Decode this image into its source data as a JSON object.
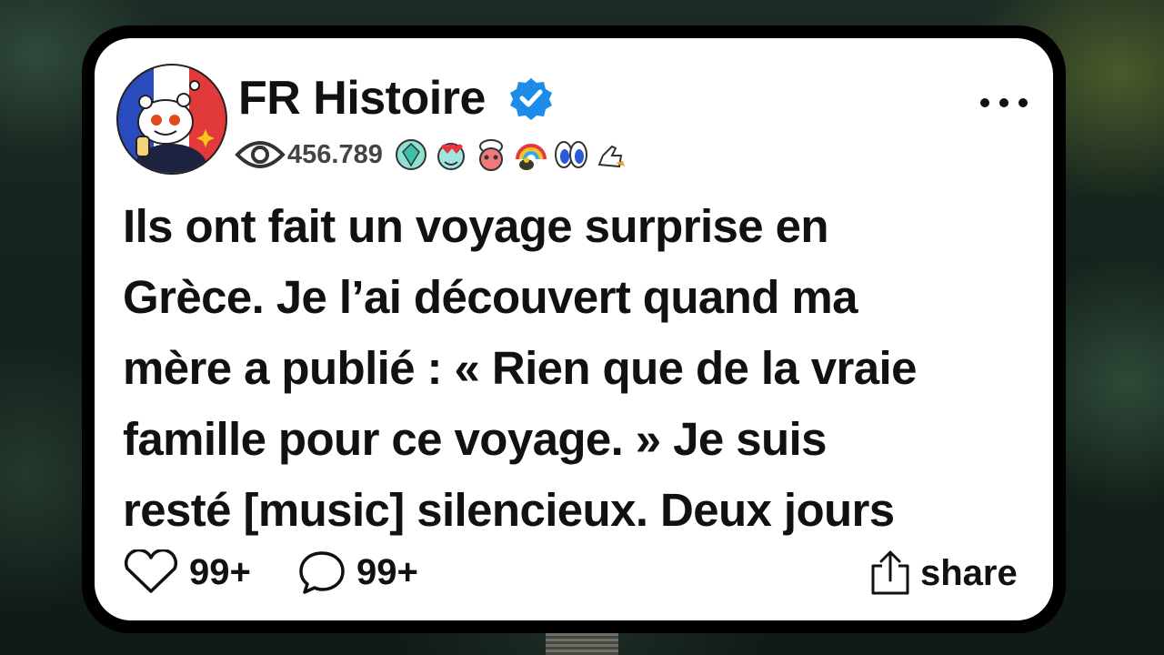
{
  "post": {
    "author": "FR Histoire",
    "verified": true,
    "views": "456.789",
    "awards": [
      "turquoise-gem-award-icon",
      "heart-eyes-award-icon",
      "chef-award-icon",
      "rainbow-pot-award-icon",
      "eyes-award-icon",
      "thumbs-up-rocket-award-icon"
    ],
    "text_lines": [
      "Ils ont fait un voyage surprise en",
      "Grèce. Je l’ai découvert quand ma",
      "mère a publié : « Rien que de la vraie",
      "famille pour ce voyage. » Je suis",
      "resté [music] silencieux. Deux jours"
    ]
  },
  "actions": {
    "likes": "99+",
    "comments": "99+",
    "share_label": "share"
  },
  "colors": {
    "verified_badge": "#1d8be8",
    "card_background": "#ffffff",
    "card_border": "#000000",
    "avatar_flag": [
      "#2a4bbd",
      "#ffffff",
      "#e23a3a"
    ]
  }
}
